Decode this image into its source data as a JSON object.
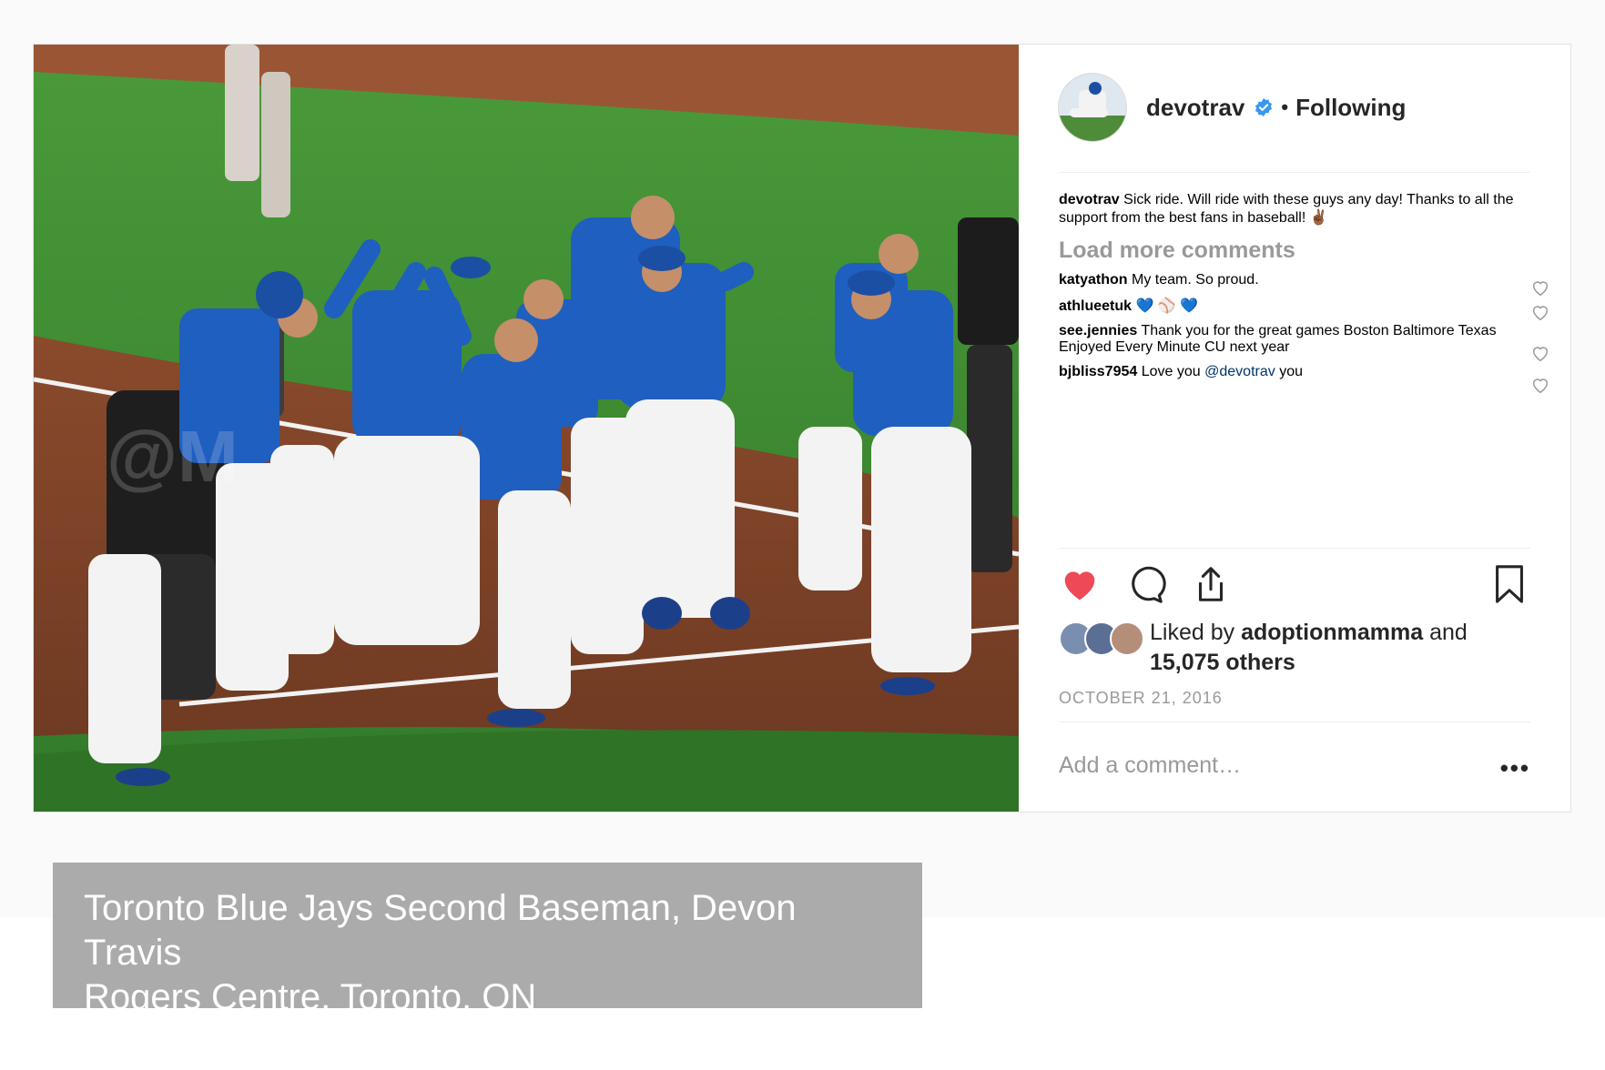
{
  "post": {
    "photo_alt": "Toronto Blue Jays players celebrating on the field",
    "header": {
      "username": "devotrav",
      "verified_icon": "verified-badge-icon",
      "separator": "•",
      "follow_status": "Following"
    },
    "caption": {
      "username": "devotrav",
      "text": "Sick ride. Will ride with these guys any day! Thanks to all the support from the best fans in baseball! ✌🏾"
    },
    "load_more": "Load more comments",
    "comments": [
      {
        "username": "katyathon",
        "text": "My team. So proud."
      },
      {
        "username": "athlueetuk",
        "text": "💙 ⚾ 💙"
      },
      {
        "username": "see.jennies",
        "text": "Thank you for the great games Boston Baltimore Texas Enjoyed Every Minute CU next year"
      },
      {
        "username": "bjbliss7954",
        "text": "Love you",
        "mention": "@devotrav",
        "text_after": "you"
      }
    ],
    "actions": {
      "like_icon": "heart-filled-icon",
      "comment_icon": "comment-bubble-icon",
      "share_icon": "share-icon",
      "save_icon": "bookmark-icon",
      "liked": true
    },
    "likes": {
      "prefix": "Liked by",
      "user": "adoptionmamma",
      "conjunction": "and",
      "others": "15,075 others"
    },
    "date": "OCTOBER 21, 2016",
    "add_comment_placeholder": "Add a comment…",
    "more_options": "•••"
  },
  "photo_caption": {
    "line1": "Toronto Blue Jays Second Baseman, Devon Travis",
    "line2": "Rogers Centre, Toronto, ON"
  },
  "colors": {
    "heart": "#ed4956",
    "verified": "#3897f0",
    "text": "#262626",
    "muted": "#999999",
    "caption_bg": "#ababab"
  }
}
